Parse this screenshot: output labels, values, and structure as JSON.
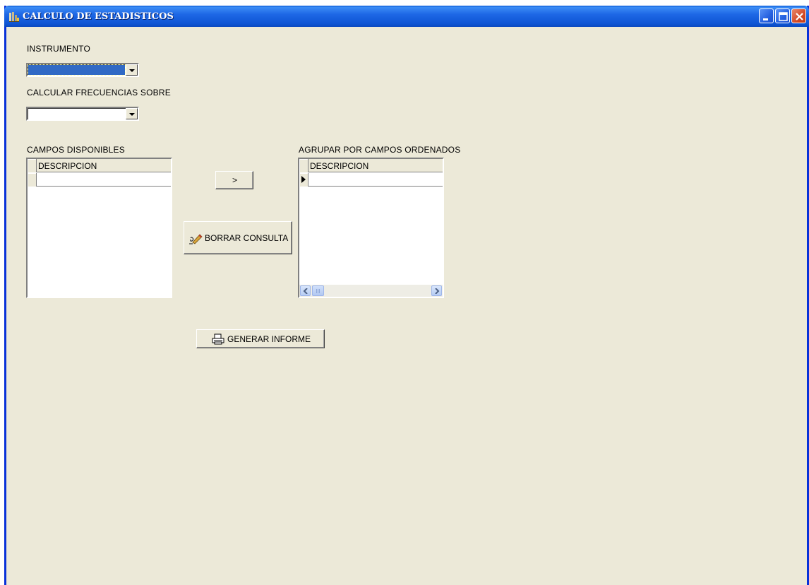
{
  "window": {
    "title": "CALCULO DE ESTADISTICOS",
    "buttons": {
      "minimize": "minimize",
      "maximize": "maximize",
      "close": "close"
    }
  },
  "form": {
    "instrumento_label": "INSTRUMENTO",
    "instrumento_value": "",
    "frecuencias_label": "CALCULAR FRECUENCIAS SOBRE",
    "frecuencias_value": "",
    "campos_disponibles_label": "CAMPOS DISPONIBLES",
    "agrupar_label": "AGRUPAR POR CAMPOS ORDENADOS",
    "grid_column": "DESCRIPCION"
  },
  "buttons": {
    "move_right": ">",
    "borrar_consulta": "BORRAR CONSULTA",
    "generar_informe": "GENERAR INFORME"
  },
  "icons": {
    "app": "app-icon",
    "eraser": "eraser-icon",
    "printer": "printer-icon",
    "row_pointer": "row-pointer-icon"
  },
  "colors": {
    "titlebar": "#0a5bd8",
    "selection": "#316ac5",
    "window_bg": "#ece9d8",
    "close": "#d34a26"
  }
}
